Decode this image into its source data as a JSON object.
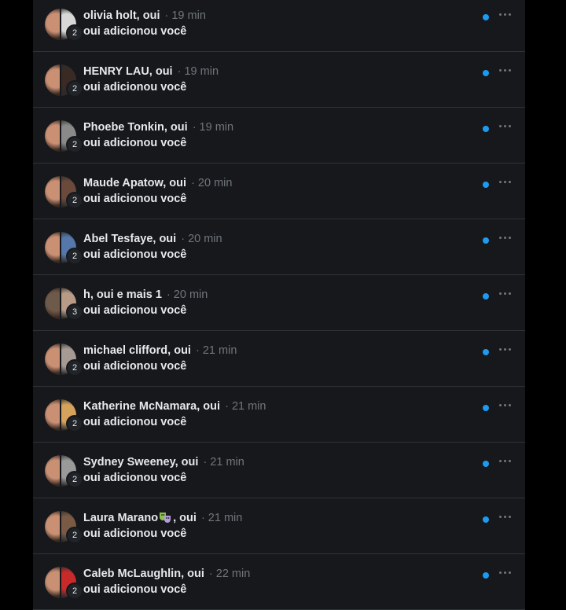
{
  "notifications": [
    {
      "name": "olivia holt, oui",
      "time": "· 19 min",
      "message": "oui adicionou você",
      "count": "2",
      "colors": [
        "#c99074",
        "#d8d8d8"
      ]
    },
    {
      "name": "HENRY LAU, oui",
      "time": "· 19 min",
      "message": "oui adicionou você",
      "count": "2",
      "colors": [
        "#c99074",
        "#3a2a24"
      ]
    },
    {
      "name": "Phoebe Tonkin, oui",
      "time": "· 19 min",
      "message": "oui adicionou você",
      "count": "2",
      "colors": [
        "#c99074",
        "#8a8a8a"
      ]
    },
    {
      "name": "Maude Apatow, oui",
      "time": "· 20 min",
      "message": "oui adicionou você",
      "count": "2",
      "colors": [
        "#c99074",
        "#6b4a3c"
      ]
    },
    {
      "name": "Abel Tesfaye, oui",
      "time": "· 20 min",
      "message": "oui adicionou você",
      "count": "2",
      "colors": [
        "#c99074",
        "#5577aa"
      ]
    },
    {
      "name": "h, oui e mais 1",
      "time": "· 20 min",
      "message": "oui adicionou você",
      "count": "3",
      "colors": [
        "#6e5a4a",
        "#b89a86"
      ]
    },
    {
      "name": "michael clifford, oui",
      "time": "· 21 min",
      "message": "oui adicionou você",
      "count": "2",
      "colors": [
        "#c99074",
        "#a59a94"
      ]
    },
    {
      "name": "Katherine McNamara, oui",
      "time": "· 21 min",
      "message": "oui adicionou você",
      "count": "2",
      "colors": [
        "#c99074",
        "#d6a35c"
      ]
    },
    {
      "name": "Sydney Sweeney, oui",
      "time": "· 21 min",
      "message": "oui adicionou você",
      "count": "2",
      "colors": [
        "#c99074",
        "#9a9a9a"
      ]
    },
    {
      "name_before": "Laura Marano",
      "name_after": ", oui",
      "emoji": "theater-masks-emoji",
      "time": "· 21 min",
      "message": "oui adicionou você",
      "count": "2",
      "colors": [
        "#c99074",
        "#7a5a44"
      ]
    },
    {
      "name": "Caleb McLaughlin, oui",
      "time": "· 22 min",
      "message": "oui adicionou você",
      "count": "2",
      "colors": [
        "#c99074",
        "#c82a2a"
      ]
    }
  ],
  "more_icon": "more-horizontal-icon",
  "unread_icon": "unread-dot-icon",
  "accent": "#1d9bf0"
}
